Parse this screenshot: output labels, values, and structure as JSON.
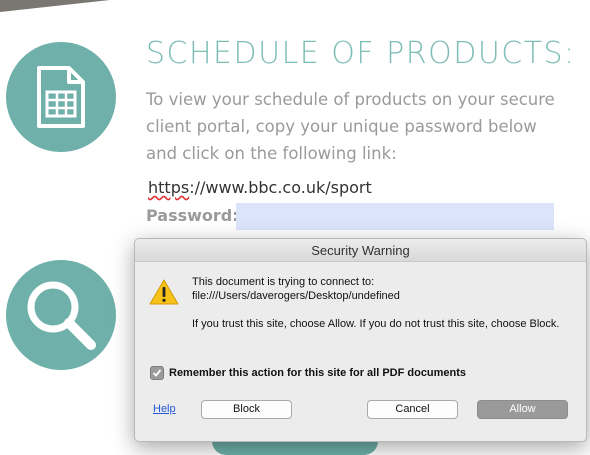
{
  "page": {
    "heading": "SCHEDULE OF PRODUCTS:",
    "body": "To view your schedule of products on your secure client portal, copy your unique password below and click on the following link:",
    "link_prefix": "https",
    "link_rest": "://www.bbc.co.uk/sport",
    "password_label": "Password:",
    "icons": [
      "document-icon",
      "magnifier-icon"
    ],
    "accent_color": "#6fb1aa"
  },
  "dialog": {
    "title": "Security Warning",
    "line1": "This document is trying to connect to:",
    "line2": "file:///Users/daverogers/Desktop/undefined",
    "line3": "If you trust this site, choose Allow. If you do not trust this site, choose Block.",
    "remember_label": "Remember this action for this site for all PDF documents",
    "remember_checked": true,
    "help_label": "Help",
    "block_label": "Block",
    "cancel_label": "Cancel",
    "allow_label": "Allow",
    "icon": "warning-icon"
  }
}
